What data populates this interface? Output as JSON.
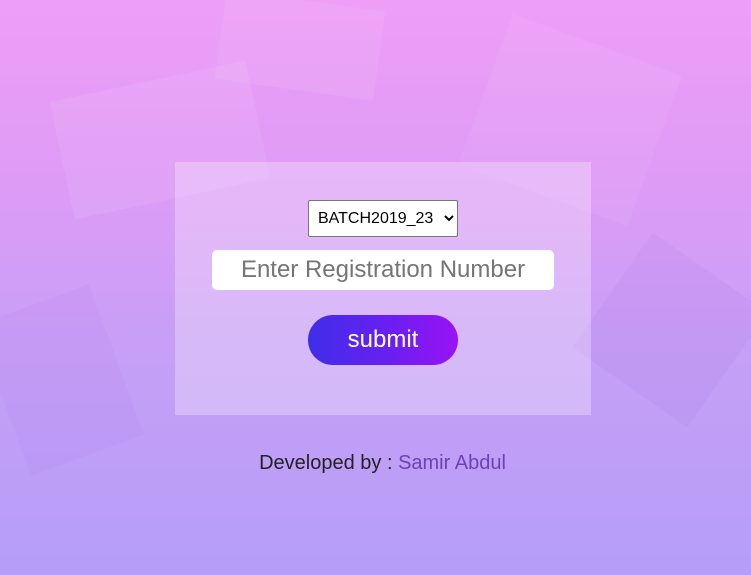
{
  "form": {
    "batch_select": {
      "selected": "BATCH2019_23",
      "options": [
        "BATCH2019_23"
      ]
    },
    "registration_input": {
      "placeholder": "Enter Registration Number",
      "value": ""
    },
    "submit_label": "submit"
  },
  "footer": {
    "prefix": "Developed by : ",
    "author": "Samir Abdul"
  },
  "colors": {
    "button_gradient_start": "#3f2ee8",
    "button_gradient_end": "#9a13f5",
    "author_link": "#6f3fb8"
  }
}
